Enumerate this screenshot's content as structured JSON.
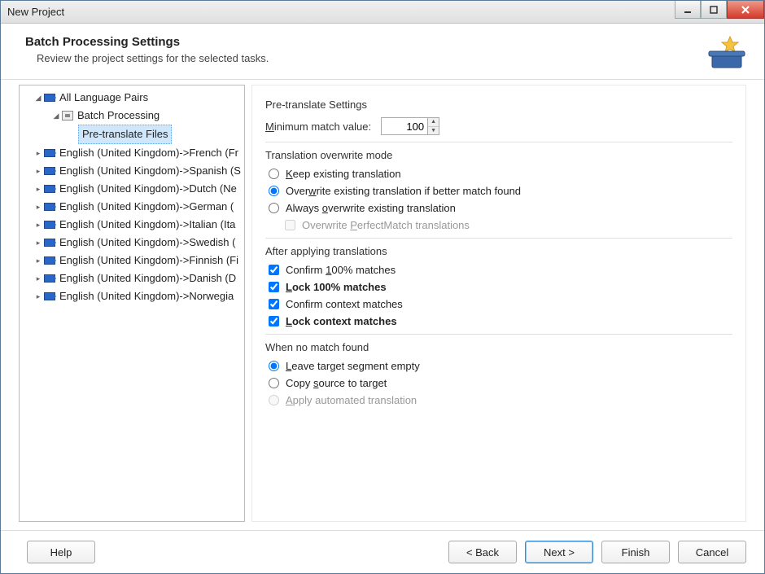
{
  "window": {
    "title": "New Project"
  },
  "header": {
    "title": "Batch Processing Settings",
    "subtitle": "Review the project settings for the selected tasks."
  },
  "tree": {
    "root": "All Language Pairs",
    "batch": "Batch Processing",
    "selected": "Pre-translate Files",
    "pairs": [
      "English (United Kingdom)->French (Fr",
      "English (United Kingdom)->Spanish (S",
      "English (United Kingdom)->Dutch (Ne",
      "English (United Kingdom)->German (",
      "English (United Kingdom)->Italian (Ita",
      "English (United Kingdom)->Swedish (",
      "English (United Kingdom)->Finnish (Fi",
      "English (United Kingdom)->Danish (D",
      "English (United Kingdom)->Norwegia"
    ]
  },
  "pretranslate": {
    "section": "Pre-translate Settings",
    "min_label_pre": "M",
    "min_label_rest": "inimum match value:",
    "min_value": "100"
  },
  "overwrite": {
    "section": "Translation overwrite mode",
    "keep_pre": "K",
    "keep_rest": "eep existing translation",
    "over_pre": "Over",
    "over_u": "w",
    "over_rest": "rite existing translation if better match found",
    "always_pre": "Always ",
    "always_u": "o",
    "always_rest": "verwrite existing translation",
    "pm_pre": "Overwrite ",
    "pm_u": "P",
    "pm_rest": "erfectMatch translations"
  },
  "after": {
    "section": "After applying translations",
    "c100_pre": "Confirm ",
    "c100_u": "1",
    "c100_rest": "00% matches",
    "l100_u": "L",
    "l100_rest": "ock 100% matches",
    "cctx": "Confirm context matches",
    "lctx_u": "L",
    "lctx_rest": "ock context matches"
  },
  "nomatch": {
    "section": "When no match found",
    "leave_pre": "L",
    "leave_rest": "eave target segment empty",
    "copy_pre": "Copy ",
    "copy_u": "s",
    "copy_rest": "ource to target",
    "auto_pre": "A",
    "auto_rest": "pply automated translation"
  },
  "buttons": {
    "help": "Help",
    "back": "< Back",
    "next": "Next >",
    "finish": "Finish",
    "cancel": "Cancel"
  }
}
